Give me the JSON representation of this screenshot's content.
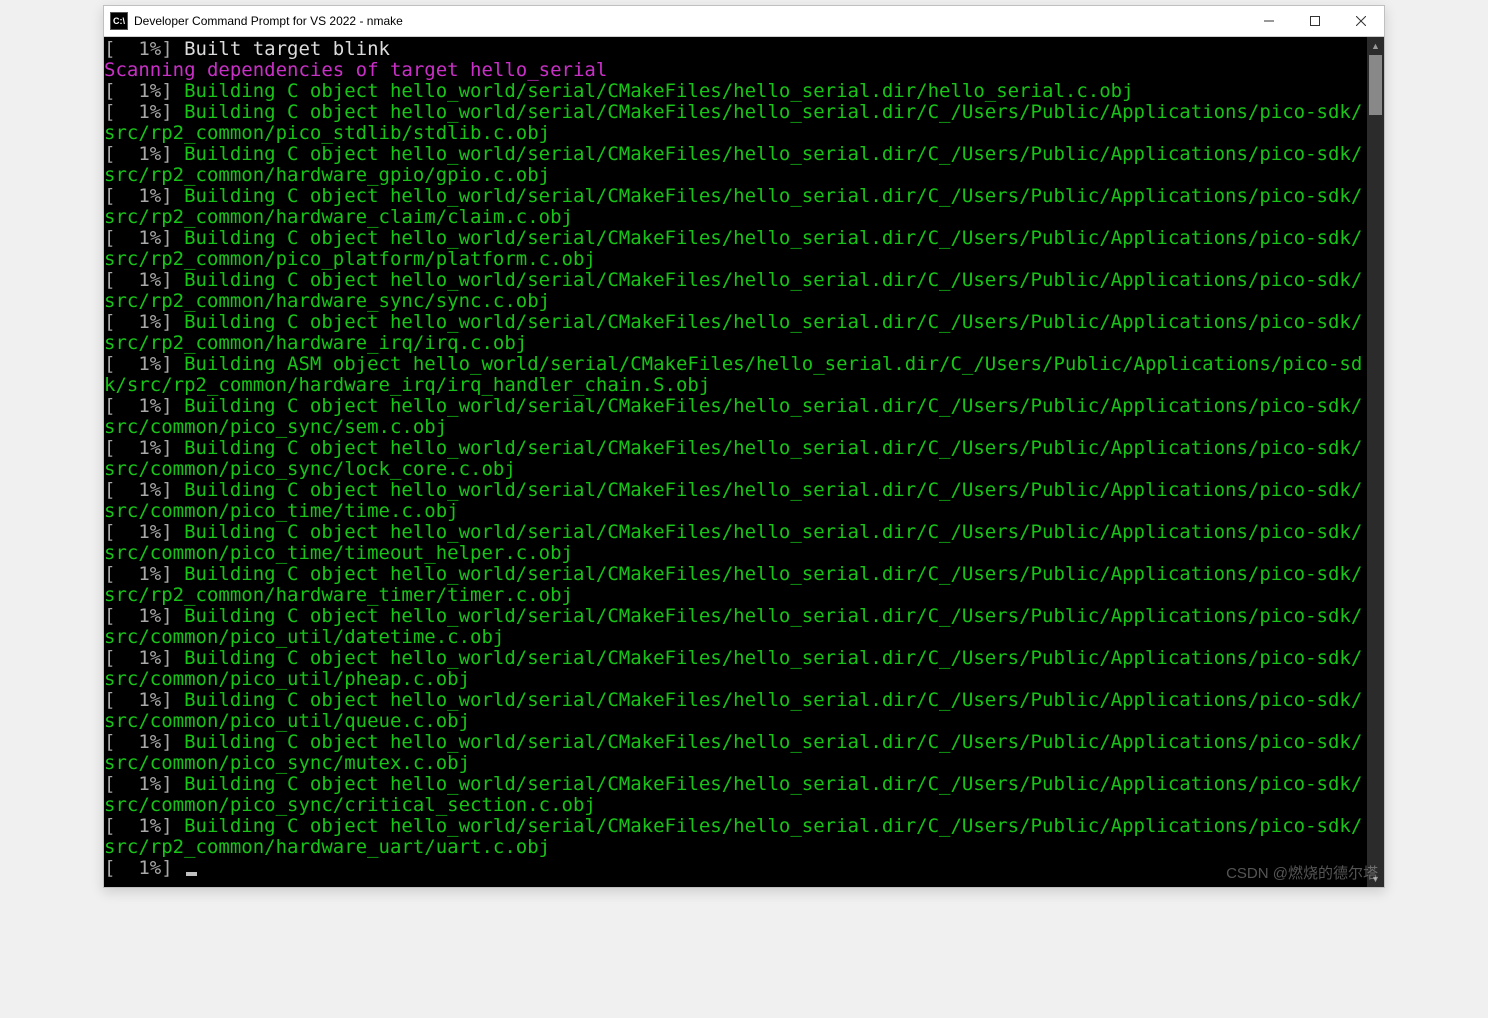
{
  "window": {
    "title": "Developer Command Prompt for VS 2022 - nmake",
    "icon_label": "C:\\"
  },
  "watermark": "CSDN @燃烧的德尔塔",
  "lines": [
    {
      "percent": "[  1%] ",
      "pclass": "c-gray",
      "text": "Built target blink",
      "tclass": "c-white"
    },
    {
      "percent": "",
      "pclass": "",
      "text": "Scanning dependencies of target hello_serial",
      "tclass": "c-magenta"
    },
    {
      "percent": "[  1%] ",
      "pclass": "c-gray",
      "text": "Building C object hello_world/serial/CMakeFiles/hello_serial.dir/hello_serial.c.obj",
      "tclass": "c-green"
    },
    {
      "percent": "[  1%] ",
      "pclass": "c-gray",
      "text": "Building C object hello_world/serial/CMakeFiles/hello_serial.dir/C_/Users/Public/Applications/pico-sdk/src/rp2_common/pico_stdlib/stdlib.c.obj",
      "tclass": "c-green"
    },
    {
      "percent": "[  1%] ",
      "pclass": "c-gray",
      "text": "Building C object hello_world/serial/CMakeFiles/hello_serial.dir/C_/Users/Public/Applications/pico-sdk/src/rp2_common/hardware_gpio/gpio.c.obj",
      "tclass": "c-green"
    },
    {
      "percent": "[  1%] ",
      "pclass": "c-gray",
      "text": "Building C object hello_world/serial/CMakeFiles/hello_serial.dir/C_/Users/Public/Applications/pico-sdk/src/rp2_common/hardware_claim/claim.c.obj",
      "tclass": "c-green"
    },
    {
      "percent": "[  1%] ",
      "pclass": "c-gray",
      "text": "Building C object hello_world/serial/CMakeFiles/hello_serial.dir/C_/Users/Public/Applications/pico-sdk/src/rp2_common/pico_platform/platform.c.obj",
      "tclass": "c-green"
    },
    {
      "percent": "[  1%] ",
      "pclass": "c-gray",
      "text": "Building C object hello_world/serial/CMakeFiles/hello_serial.dir/C_/Users/Public/Applications/pico-sdk/src/rp2_common/hardware_sync/sync.c.obj",
      "tclass": "c-green"
    },
    {
      "percent": "[  1%] ",
      "pclass": "c-gray",
      "text": "Building C object hello_world/serial/CMakeFiles/hello_serial.dir/C_/Users/Public/Applications/pico-sdk/src/rp2_common/hardware_irq/irq.c.obj",
      "tclass": "c-green"
    },
    {
      "percent": "[  1%] ",
      "pclass": "c-gray",
      "text": "Building ASM object hello_world/serial/CMakeFiles/hello_serial.dir/C_/Users/Public/Applications/pico-sdk/src/rp2_common/hardware_irq/irq_handler_chain.S.obj",
      "tclass": "c-green"
    },
    {
      "percent": "[  1%] ",
      "pclass": "c-gray",
      "text": "Building C object hello_world/serial/CMakeFiles/hello_serial.dir/C_/Users/Public/Applications/pico-sdk/src/common/pico_sync/sem.c.obj",
      "tclass": "c-green"
    },
    {
      "percent": "[  1%] ",
      "pclass": "c-gray",
      "text": "Building C object hello_world/serial/CMakeFiles/hello_serial.dir/C_/Users/Public/Applications/pico-sdk/src/common/pico_sync/lock_core.c.obj",
      "tclass": "c-green"
    },
    {
      "percent": "[  1%] ",
      "pclass": "c-gray",
      "text": "Building C object hello_world/serial/CMakeFiles/hello_serial.dir/C_/Users/Public/Applications/pico-sdk/src/common/pico_time/time.c.obj",
      "tclass": "c-green"
    },
    {
      "percent": "[  1%] ",
      "pclass": "c-gray",
      "text": "Building C object hello_world/serial/CMakeFiles/hello_serial.dir/C_/Users/Public/Applications/pico-sdk/src/common/pico_time/timeout_helper.c.obj",
      "tclass": "c-green"
    },
    {
      "percent": "[  1%] ",
      "pclass": "c-gray",
      "text": "Building C object hello_world/serial/CMakeFiles/hello_serial.dir/C_/Users/Public/Applications/pico-sdk/src/rp2_common/hardware_timer/timer.c.obj",
      "tclass": "c-green"
    },
    {
      "percent": "[  1%] ",
      "pclass": "c-gray",
      "text": "Building C object hello_world/serial/CMakeFiles/hello_serial.dir/C_/Users/Public/Applications/pico-sdk/src/common/pico_util/datetime.c.obj",
      "tclass": "c-green"
    },
    {
      "percent": "[  1%] ",
      "pclass": "c-gray",
      "text": "Building C object hello_world/serial/CMakeFiles/hello_serial.dir/C_/Users/Public/Applications/pico-sdk/src/common/pico_util/pheap.c.obj",
      "tclass": "c-green"
    },
    {
      "percent": "[  1%] ",
      "pclass": "c-gray",
      "text": "Building C object hello_world/serial/CMakeFiles/hello_serial.dir/C_/Users/Public/Applications/pico-sdk/src/common/pico_util/queue.c.obj",
      "tclass": "c-green"
    },
    {
      "percent": "[  1%] ",
      "pclass": "c-gray",
      "text": "Building C object hello_world/serial/CMakeFiles/hello_serial.dir/C_/Users/Public/Applications/pico-sdk/src/common/pico_sync/mutex.c.obj",
      "tclass": "c-green"
    },
    {
      "percent": "[  1%] ",
      "pclass": "c-gray",
      "text": "Building C object hello_world/serial/CMakeFiles/hello_serial.dir/C_/Users/Public/Applications/pico-sdk/src/common/pico_sync/critical_section.c.obj",
      "tclass": "c-green"
    },
    {
      "percent": "[  1%] ",
      "pclass": "c-gray",
      "text": "Building C object hello_world/serial/CMakeFiles/hello_serial.dir/C_/Users/Public/Applications/pico-sdk/src/rp2_common/hardware_uart/uart.c.obj",
      "tclass": "c-green"
    },
    {
      "percent": "[  1%] ",
      "pclass": "c-gray",
      "text": "",
      "tclass": "c-green",
      "cursor": true
    }
  ]
}
